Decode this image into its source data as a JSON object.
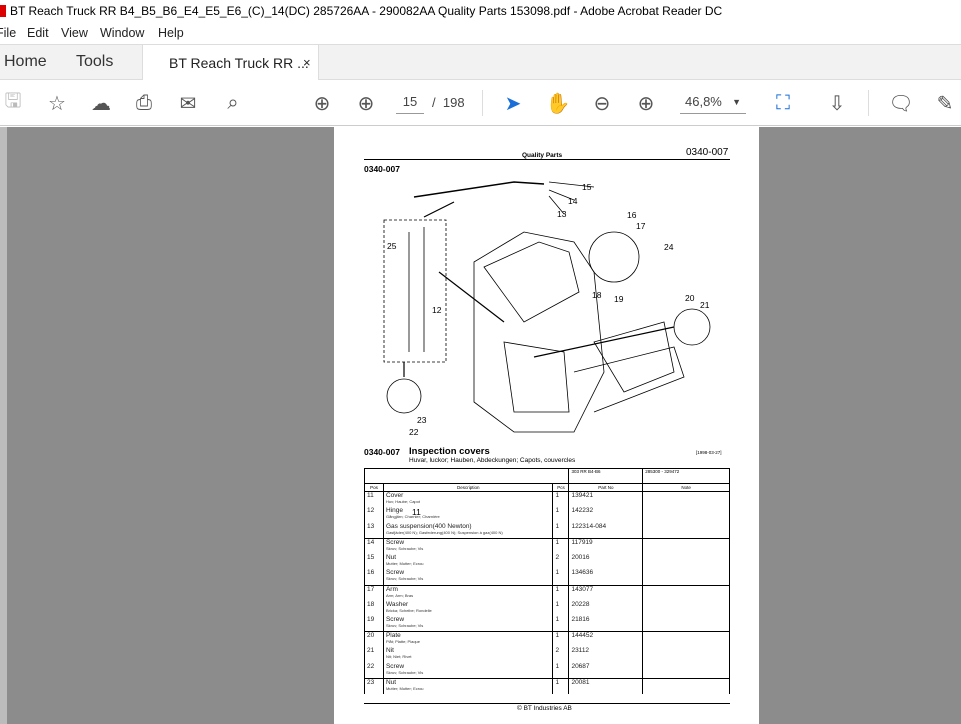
{
  "window": {
    "title": "BT Reach Truck RR B4_B5_B6_E4_E5_E6_(C)_14(DC) 285726AA - 290082AA Quality Parts 153098.pdf - Adobe Acrobat Reader DC"
  },
  "menu": [
    "File",
    "Edit",
    "View",
    "Window",
    "Help"
  ],
  "tabs": {
    "home": "Home",
    "tools": "Tools",
    "document": "BT Reach Truck RR ...",
    "close": "×"
  },
  "toolbar": {
    "page_current": "15",
    "page_separator": "/",
    "page_total": "198",
    "zoom": "46,8%"
  },
  "document": {
    "header_center": "Quality Parts",
    "header_right": "0340-007",
    "figure_code": "0340-007",
    "callouts": [
      "11",
      "12",
      "13",
      "14",
      "15",
      "16",
      "17",
      "18",
      "19",
      "20",
      "21",
      "22",
      "23",
      "24",
      "25"
    ],
    "section_code": "0340-007",
    "section_title": "Inspection covers",
    "section_subtitle": "Huvar, luckor; Hauben, Abdeckungen; Capots, couvercles",
    "section_date": "[1998-03-27]",
    "table_meta": {
      "model": "303   RR B4-B6",
      "serial_range": "285300 - 329472"
    },
    "columns": [
      "Pos",
      "Description",
      "Pcs",
      "Part No",
      "Note"
    ],
    "rows": [
      {
        "pos": "11",
        "desc": "Cover",
        "trans": "Huv; Haube; Capot",
        "pcs": "1",
        "part": "139421",
        "group_start": true
      },
      {
        "pos": "12",
        "desc": "Hinge",
        "trans": "Gångjärn; Charnier; Charnière",
        "pcs": "1",
        "part": "142232"
      },
      {
        "pos": "13",
        "desc": "Gas suspension(400 Newton)",
        "trans": "Gasfjäder(400 N); Gasfederung(400 N); Suspension à gaz(400 N)",
        "pcs": "1",
        "part": "122314-084"
      },
      {
        "pos": "14",
        "desc": "Screw",
        "trans": "Skruv; Schraube; Vis",
        "pcs": "1",
        "part": "117919",
        "group_start": true
      },
      {
        "pos": "15",
        "desc": "Nut",
        "trans": "Mutter; Mutter; Ecrou",
        "pcs": "2",
        "part": "20016"
      },
      {
        "pos": "16",
        "desc": "Screw",
        "trans": "Skruv; Schraube; Vis",
        "pcs": "1",
        "part": "134636"
      },
      {
        "pos": "17",
        "desc": "Arm",
        "trans": "Arm; Arm; Bras",
        "pcs": "1",
        "part": "143077",
        "group_start": true
      },
      {
        "pos": "18",
        "desc": "Washer",
        "trans": "Bricka; Scheibe; Rondelle",
        "pcs": "1",
        "part": "20228"
      },
      {
        "pos": "19",
        "desc": "Screw",
        "trans": "Skruv; Schraube; Vis",
        "pcs": "1",
        "part": "21816"
      },
      {
        "pos": "20",
        "desc": "Plate",
        "trans": "Plåt; Platte; Plaque",
        "pcs": "1",
        "part": "144452",
        "group_start": true
      },
      {
        "pos": "21",
        "desc": "Nit",
        "trans": "Nit; Niet; Rivet",
        "pcs": "2",
        "part": "23112"
      },
      {
        "pos": "22",
        "desc": "Screw",
        "trans": "Skruv; Schraube; Vis",
        "pcs": "1",
        "part": "20687"
      },
      {
        "pos": "23",
        "desc": "Nut",
        "trans": "Mutter; Mutter; Ecrou",
        "pcs": "1",
        "part": "20081",
        "group_start": true
      }
    ],
    "footer": "© BT Industries AB"
  }
}
